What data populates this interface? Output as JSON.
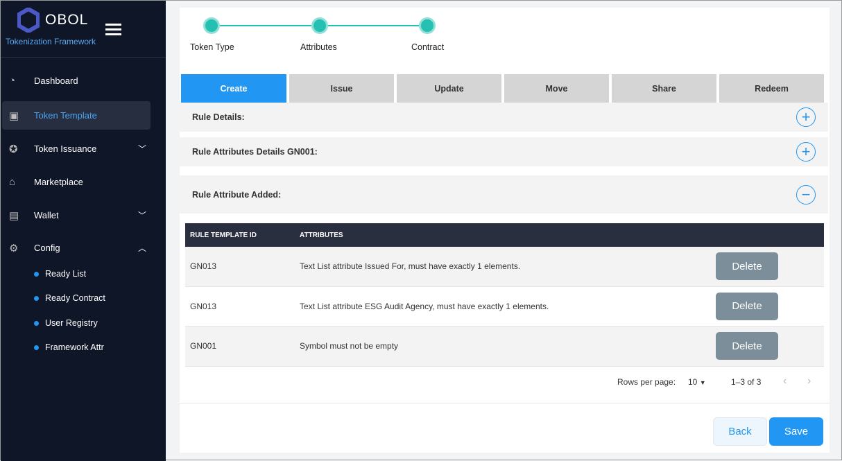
{
  "app": {
    "name": "OBOL",
    "subtitle": "Tokenization Framework"
  },
  "sidebar": {
    "items": [
      {
        "label": "Dashboard",
        "icon": "gauge-icon"
      },
      {
        "label": "Token Template",
        "icon": "template-icon"
      },
      {
        "label": "Token Issuance",
        "icon": "coin-icon"
      },
      {
        "label": "Marketplace",
        "icon": "store-icon"
      },
      {
        "label": "Wallet",
        "icon": "wallet-icon"
      },
      {
        "label": "Config",
        "icon": "config-icon"
      }
    ],
    "config_sub": [
      "Ready List",
      "Ready Contract",
      "User Registry",
      "Framework Attr"
    ]
  },
  "stepper": [
    "Token Type",
    "Attributes",
    "Contract"
  ],
  "tabs": [
    "Create",
    "Issue",
    "Update",
    "Move",
    "Share",
    "Redeem"
  ],
  "sections": {
    "rule_details": "Rule Details:",
    "rule_attr_details": "Rule Attributes Details GN001:",
    "rule_attr_added": "Rule Attribute Added:"
  },
  "table": {
    "headers": [
      "RULE TEMPLATE ID",
      "ATTRIBUTES"
    ],
    "rows": [
      {
        "id": "GN013",
        "attr": "Text List attribute Issued For, must have exactly 1 elements.",
        "action": "Delete"
      },
      {
        "id": "GN013",
        "attr": "Text List attribute ESG Audit Agency, must have exactly 1 elements.",
        "action": "Delete"
      },
      {
        "id": "GN001",
        "attr": "Symbol must not be empty",
        "action": "Delete"
      }
    ]
  },
  "pagination": {
    "rows_label": "Rows per page:",
    "rows_value": "10",
    "range": "1–3 of 3"
  },
  "buttons": {
    "back": "Back",
    "save": "Save"
  },
  "colors": {
    "accent": "#2196f3",
    "sidebar": "#0f1628",
    "step": "#26c0b2"
  }
}
